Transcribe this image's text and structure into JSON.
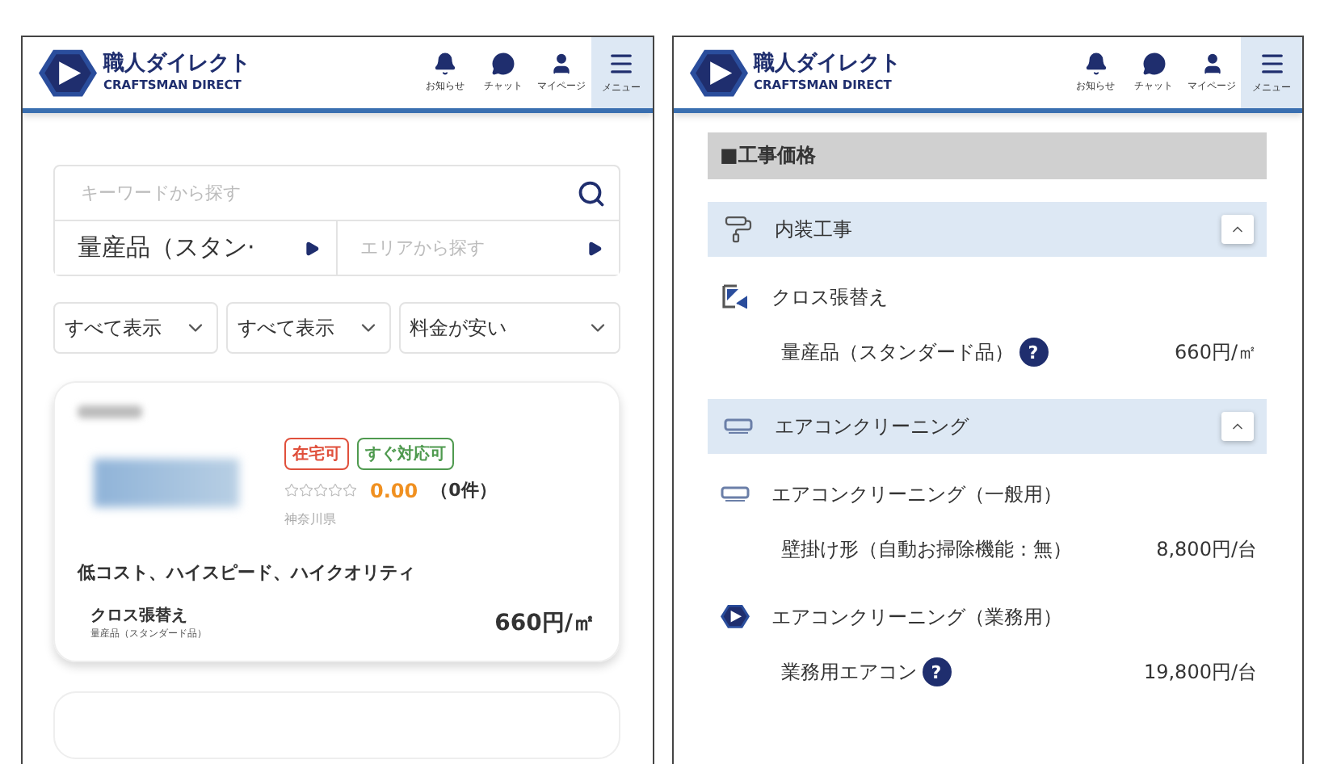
{
  "search_screen": {
    "header": {
      "logo_title": "職人ダイレクト",
      "logo_subtitle": "CRAFTSMAN DIRECT",
      "nav": [
        {
          "kind": "bell",
          "label": "お知らせ"
        },
        {
          "kind": "chat",
          "label": "チャット"
        },
        {
          "kind": "user",
          "label": "マイページ"
        },
        {
          "kind": "menu",
          "label": "メニュー"
        }
      ]
    },
    "search": {
      "keyword_placeholder": "キーワードから探す",
      "category_value": "量産品（スタン·",
      "area_placeholder": "エリアから探す"
    },
    "filters": [
      "すべて表示",
      "すべて表示",
      "料金が安い"
    ],
    "card": {
      "tags": [
        {
          "label": "在宅可",
          "color": "#e0503c"
        },
        {
          "label": "すぐ対応可",
          "color": "#4f9a4f"
        }
      ],
      "stars": 0,
      "rating": "0.00",
      "review_count": "（0件）",
      "location": "神奈川県",
      "tagline": "低コスト、ハイスピード、ハイクオリティ",
      "service": {
        "name": "クロス張替え",
        "variant": "量産品（スタンダード品）",
        "price": "660円/㎡"
      }
    }
  },
  "price_screen": {
    "header": {
      "logo_title": "職人ダイレクト",
      "logo_subtitle": "CRAFTSMAN DIRECT",
      "nav": [
        {
          "kind": "bell",
          "label": "お知らせ"
        },
        {
          "kind": "chat",
          "label": "チャット"
        },
        {
          "kind": "user",
          "label": "マイページ"
        },
        {
          "kind": "menu",
          "label": "メニュー"
        }
      ]
    },
    "section_title": "■工事価格",
    "categories": [
      {
        "kind": "roller",
        "label": "内装工事",
        "expanded": true,
        "items": [
          {
            "kind": "wallpaper",
            "name": "クロス張替え",
            "rows": [
              {
                "label": "量産品（スタンダード品）",
                "help": "?",
                "price": "660円/㎡"
              }
            ]
          }
        ]
      },
      {
        "kind": "aircon",
        "label": "エアコンクリーニング",
        "expanded": true,
        "items": [
          {
            "kind": "aircon",
            "name": "エアコンクリーニング（一般用）",
            "rows": [
              {
                "label": "壁掛け形（自動お掃除機能：無）",
                "price": "8,800円/台"
              }
            ]
          },
          {
            "kind": "logo",
            "name": "エアコンクリーニング（業務用）",
            "rows": [
              {
                "label": "業務用エアコン",
                "help": "?",
                "price": "19,800円/台"
              }
            ]
          }
        ]
      }
    ]
  }
}
